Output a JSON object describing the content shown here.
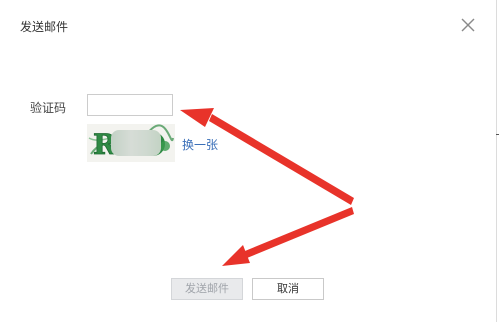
{
  "dialog": {
    "title": "发送邮件",
    "close_icon": "close-icon"
  },
  "form": {
    "captcha_label": "验证码",
    "captcha_input_value": "",
    "captcha_input_placeholder": "",
    "captcha_image_text": "Rl",
    "refresh_link": "换一张"
  },
  "buttons": {
    "send_label": "发送邮件",
    "cancel_label": "取消",
    "send_state": "disabled"
  },
  "annotations": {
    "arrow_color": "#e8332a"
  },
  "colors": {
    "link": "#3a6fb8",
    "captcha_green": "#2f8a44"
  }
}
